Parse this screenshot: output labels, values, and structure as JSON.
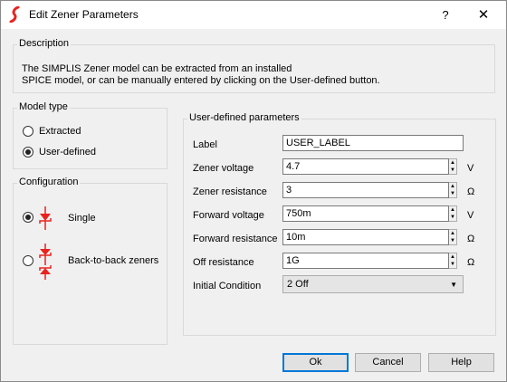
{
  "window": {
    "title": "Edit Zener Parameters",
    "help": "?",
    "close": "✕"
  },
  "description": {
    "title": "Description",
    "line1": "The SIMPLIS Zener model can be extracted from an installed",
    "line2": "SPICE model, or can be manually entered by clicking on the User-defined button."
  },
  "model_type": {
    "title": "Model type",
    "options": [
      {
        "label": "Extracted",
        "checked": false
      },
      {
        "label": "User-defined",
        "checked": true
      }
    ]
  },
  "configuration": {
    "title": "Configuration",
    "options": [
      {
        "label": "Single",
        "checked": true,
        "icon": "zener-diode-icon"
      },
      {
        "label": "Back-to-back zeners",
        "checked": false,
        "icon": "back-to-back-zener-icon"
      }
    ]
  },
  "user_defined": {
    "title": "User-defined parameters",
    "fields": [
      {
        "label": "Label",
        "value": "USER_LABEL",
        "unit": ""
      },
      {
        "label": "Zener voltage",
        "value": "4.7",
        "unit": "V"
      },
      {
        "label": "Zener resistance",
        "value": "3",
        "unit": "Ω"
      },
      {
        "label": "Forward voltage",
        "value": "750m",
        "unit": "V"
      },
      {
        "label": "Forward resistance",
        "value": "10m",
        "unit": "Ω"
      },
      {
        "label": "Off resistance",
        "value": "1G",
        "unit": "Ω"
      }
    ],
    "initial_condition": {
      "label": "Initial Condition",
      "value": "2 Off"
    }
  },
  "buttons": {
    "ok": "Ok",
    "cancel": "Cancel",
    "help": "Help"
  },
  "colors": {
    "accent": "#0078d7",
    "diode_red": "#e8231f"
  }
}
